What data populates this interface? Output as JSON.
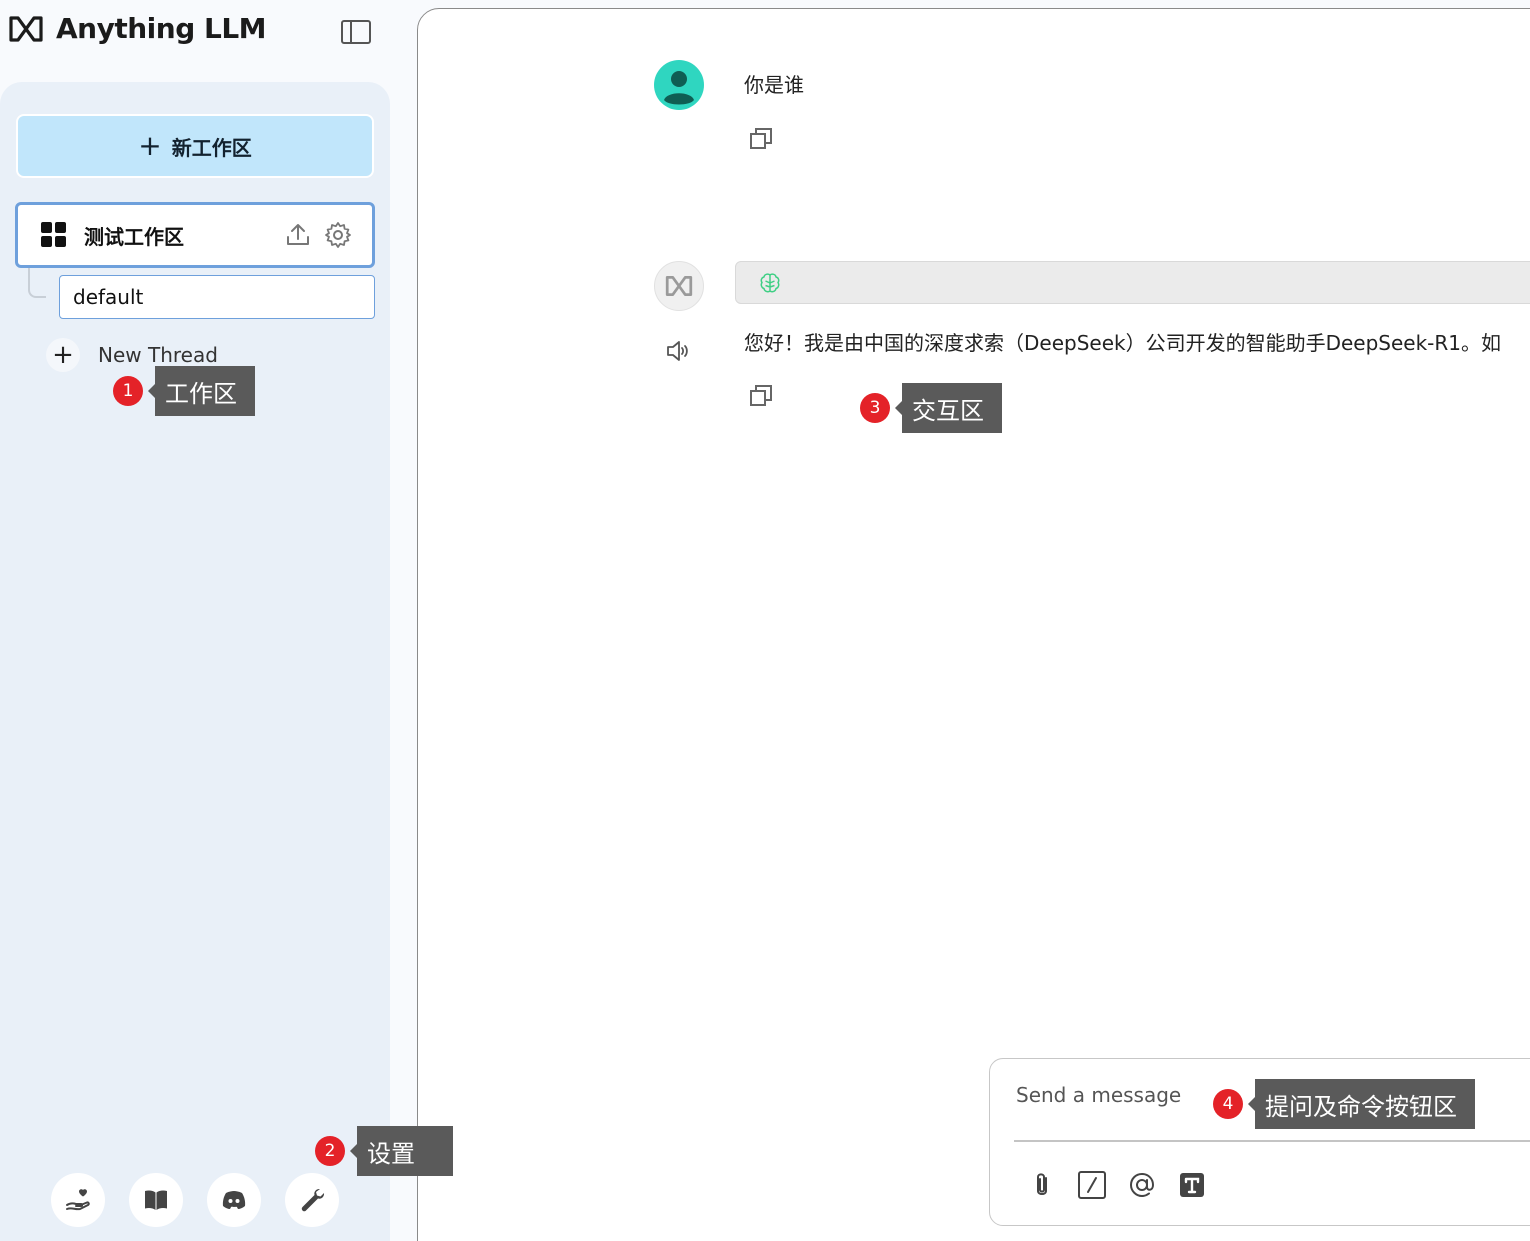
{
  "brand": {
    "name": "Anything LLM",
    "logo_icon": "anythingllm-logo-icon"
  },
  "sidebar": {
    "new_workspace_label": "新工作区",
    "workspace": {
      "name": "测试工作区",
      "icon": "grid-icon"
    },
    "threads": [
      {
        "label": "default"
      }
    ],
    "new_thread_label": "New Thread",
    "footer_icons": [
      "hand-heart-icon",
      "book-icon",
      "discord-icon",
      "wrench-icon"
    ]
  },
  "chat": {
    "messages": [
      {
        "role": "user",
        "text": "你是谁"
      },
      {
        "role": "assistant",
        "text": "您好！我是由中国的深度求索（DeepSeek）公司开发的智能助手DeepSeek-R1。如"
      }
    ],
    "input": {
      "placeholder": "Send a message",
      "value": ""
    },
    "tools": [
      "paperclip-icon",
      "slash-command-icon",
      "at-mention-icon",
      "text-format-icon"
    ]
  },
  "annotations": [
    {
      "number": "1",
      "label": "工作区"
    },
    {
      "number": "2",
      "label": "设置"
    },
    {
      "number": "3",
      "label": "交互区"
    },
    {
      "number": "4",
      "label": "提问及命令按钮区"
    }
  ],
  "colors": {
    "accent_button": "#c1e6fb",
    "workspace_border": "#6ea0dc",
    "annotation_red": "#e42228",
    "annotation_bg": "#5a5a5a",
    "user_avatar": "#2fd6c0"
  }
}
